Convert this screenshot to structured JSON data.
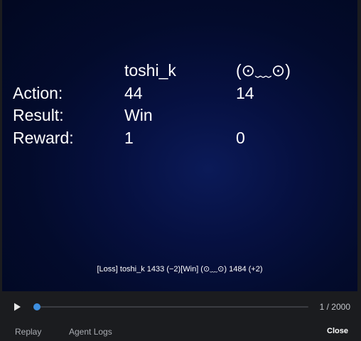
{
  "stage": {
    "header": {
      "agent1": "toshi_k",
      "agent2": "(⊙﹏⊙)"
    },
    "rows": [
      {
        "label": "Action:",
        "agent1": "44",
        "agent2": "14"
      },
      {
        "label": "Result:",
        "agent1": "Win",
        "agent2": ""
      },
      {
        "label": "Reward:",
        "agent1": "1",
        "agent2": "0"
      }
    ],
    "summary": "[Loss] toshi_k 1433 (−2)[Win] (⊙﹏⊙) 1484 (+2)",
    "background_color": "#020821"
  },
  "controls": {
    "play_icon": "play-icon",
    "step_current": 1,
    "step_total": 2000,
    "step_text": "1 / 2000",
    "accent_color": "#3d8fe0"
  },
  "footer": {
    "tab_replay": "Replay",
    "tab_agent_logs": "Agent Logs",
    "close_label": "Close"
  }
}
